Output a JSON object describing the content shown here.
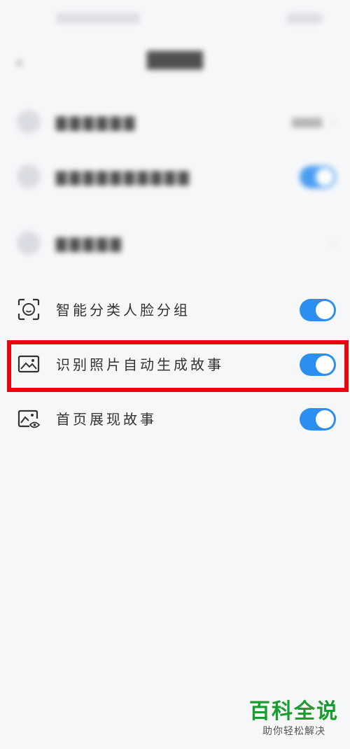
{
  "settings_rows": [
    {
      "label": "智能分类人脸分组",
      "toggle_on": true,
      "icon": "face-scan-icon"
    },
    {
      "label": "识别照片自动生成故事",
      "toggle_on": true,
      "icon": "image-icon"
    },
    {
      "label": "首页展现故事",
      "toggle_on": true,
      "icon": "image-eye-icon"
    }
  ],
  "watermark": {
    "title": "百科全说",
    "subtitle": "助你轻松解决"
  },
  "colors": {
    "accent": "#2c8ef0",
    "highlight": "#e8080b",
    "watermark": "#1a9d2e"
  }
}
